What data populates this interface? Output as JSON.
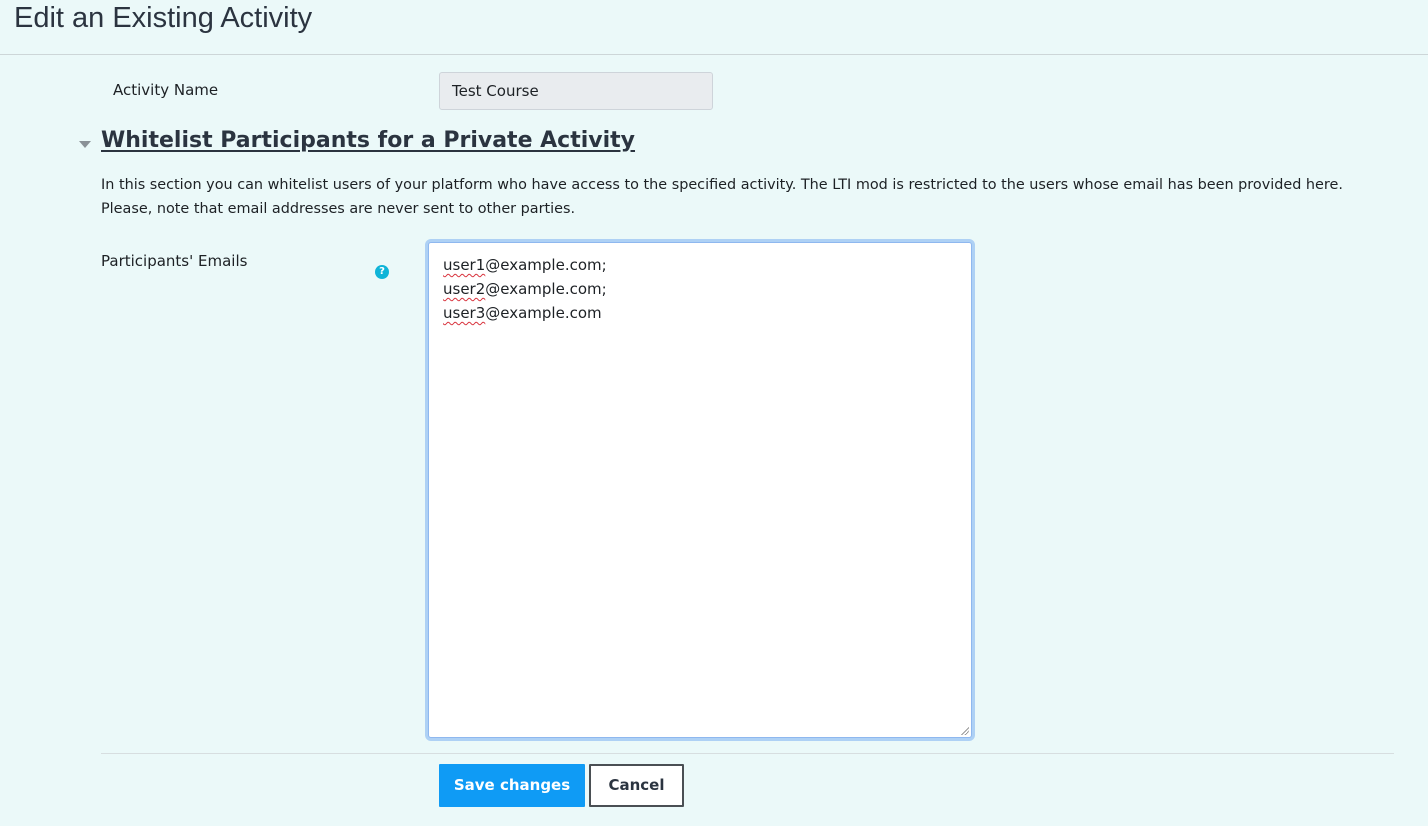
{
  "header": {
    "title": "Edit an Existing Activity"
  },
  "form": {
    "activity_name": {
      "label": "Activity Name",
      "value": "Test Course"
    },
    "section": {
      "heading": "Whitelist Participants for a Private Activity",
      "description": "In this section you can whitelist users of your platform who have access to the specified activity. The LTI mod is restricted to the users whose email has been provided here. Please, note that email addresses are never sent to other parties.",
      "expanded": true
    },
    "emails": {
      "label": "Participants' Emails",
      "help_icon": "question-circle-icon",
      "lines": [
        {
          "user": "user1",
          "rest": "@example.com;"
        },
        {
          "user": "user2",
          "rest": "@example.com;"
        },
        {
          "user": "user3",
          "rest": "@example.com"
        }
      ]
    },
    "buttons": {
      "save_label": "Save changes",
      "cancel_label": "Cancel"
    }
  },
  "colors": {
    "background": "#ebf9f9",
    "primary": "#0f9bf5",
    "help": "#0fb4d8",
    "focus": "#8fb8ef"
  }
}
